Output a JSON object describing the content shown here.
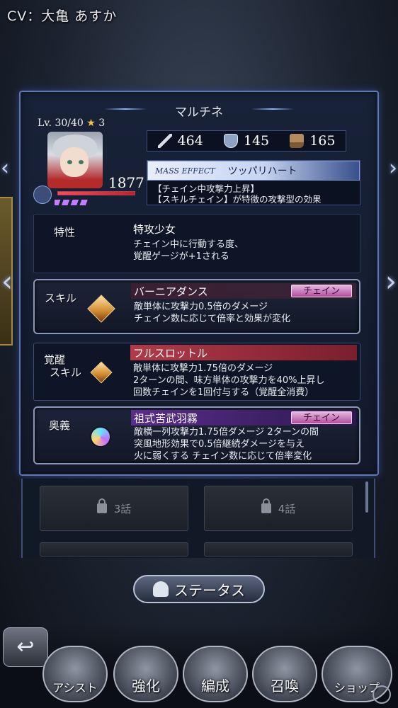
{
  "cv_label": "CV：大亀 あすか",
  "character": {
    "name": "マルチネ",
    "level_text": "Lv. 30/40",
    "star_symbol": "★",
    "stars": "3",
    "hp": "1877",
    "hp_fraction": 1.0
  },
  "stats": {
    "attack": "464",
    "defense": "145",
    "speed": "165"
  },
  "mass_effect": {
    "label": "MASS EFFECT",
    "name": "ツッパリハート",
    "desc_line1": "【チェイン中攻撃力上昇】",
    "desc_line2": "【スキルチェイン】が特徴の攻撃型の効果"
  },
  "trait": {
    "label": "特性",
    "name": "特攻少女",
    "desc_line1": "チェイン中に行動する度、",
    "desc_line2": "覚醒ゲージが+1される"
  },
  "skill": {
    "label": "スキル",
    "name": "バーニアダンス",
    "tag": "チェイン",
    "desc_line1": "敵単体に攻撃力0.5倍のダメージ",
    "desc_line2": "チェイン数に応じて倍率と効果が変化"
  },
  "awaken_skill": {
    "label_line1": "覚醒",
    "label_line2": "スキル",
    "name": "フルスロットル",
    "desc_line1": "敵単体に攻撃力1.75倍のダメージ",
    "desc_line2": "2ターンの間、味方単体の攻撃力を40%上昇し",
    "desc_line3": "回数チェインを1回付与する（覚醒全消費）"
  },
  "ougi": {
    "label": "奥義",
    "name": "祖式苦武羽霧",
    "tag": "チェイン",
    "desc_line1": "敵横一列攻撃力1.75倍ダメージ 2ターンの間",
    "desc_line2": "突風地形効果で0.5倍継続ダメージを与え",
    "desc_line3": "火に弱くする チェイン数に応じて倍率変化"
  },
  "episodes": {
    "ep3": "3話",
    "ep4": "4話"
  },
  "status_button": "ステータス",
  "nav": {
    "item1": "アシスト",
    "item2": "強化",
    "item3": "編成",
    "item4": "召喚",
    "item5": "ショップ"
  },
  "colors": {
    "panel_border": "#5f78b3",
    "awaken_band": "#b23a4a",
    "ougi_band": "#5a2d8a",
    "chain_tag": "#b24d9d"
  }
}
